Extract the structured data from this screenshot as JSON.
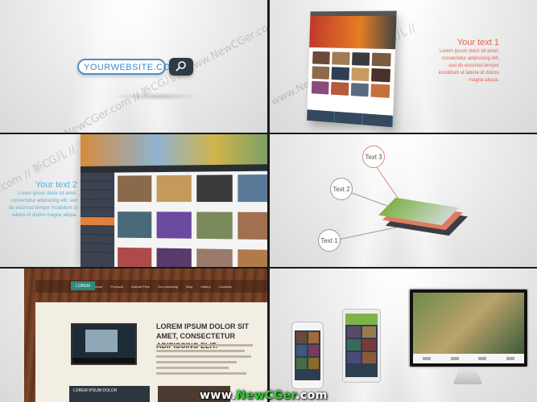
{
  "panel1": {
    "search_text": "YOURWEBSITE.COM",
    "watermark": "www.NewCGer.com // 新CG儿 // www.NewCGer.com"
  },
  "panel2": {
    "caption_head": "Your text 1",
    "caption_body": "Lorem ipsum dolor sit amet, consectetur adipisicing elit, sed do eiusmod tempor incididunt ut labore et dolore magna aliqua.",
    "accent_color": "#e8634c",
    "watermark": "www.NewCGer.com // 新CG儿 //"
  },
  "panel3": {
    "caption_head": "Your text 2",
    "caption_body": "Lorem ipsum dolor sit amet, consectetur adipisicing elit, sed do eiusmod tempor incididunt ut labore et dolore magna aliqua.",
    "accent_color": "#4fb3d9",
    "watermark": "er.com // 新CG儿 //"
  },
  "panel4": {
    "bubbles": [
      "Text 1",
      "Text 2",
      "Text 3"
    ]
  },
  "panel5": {
    "logo": "LOREM",
    "nav": [
      "Home",
      "About",
      "Products",
      "Special Price",
      "Our workshop",
      "Blog",
      "Gallery",
      "Contacts"
    ],
    "headline": "LOREM IPSUM DOLOR SIT AMET, CONSECTETUR ADIPISCING ELIT.",
    "promo": "LOREM IPSUM DOLOR"
  },
  "footer": {
    "url_prefix": "www.",
    "url_brand": "NewCGer",
    "url_suffix": ".com",
    "brand_color": "#2fd02f"
  }
}
